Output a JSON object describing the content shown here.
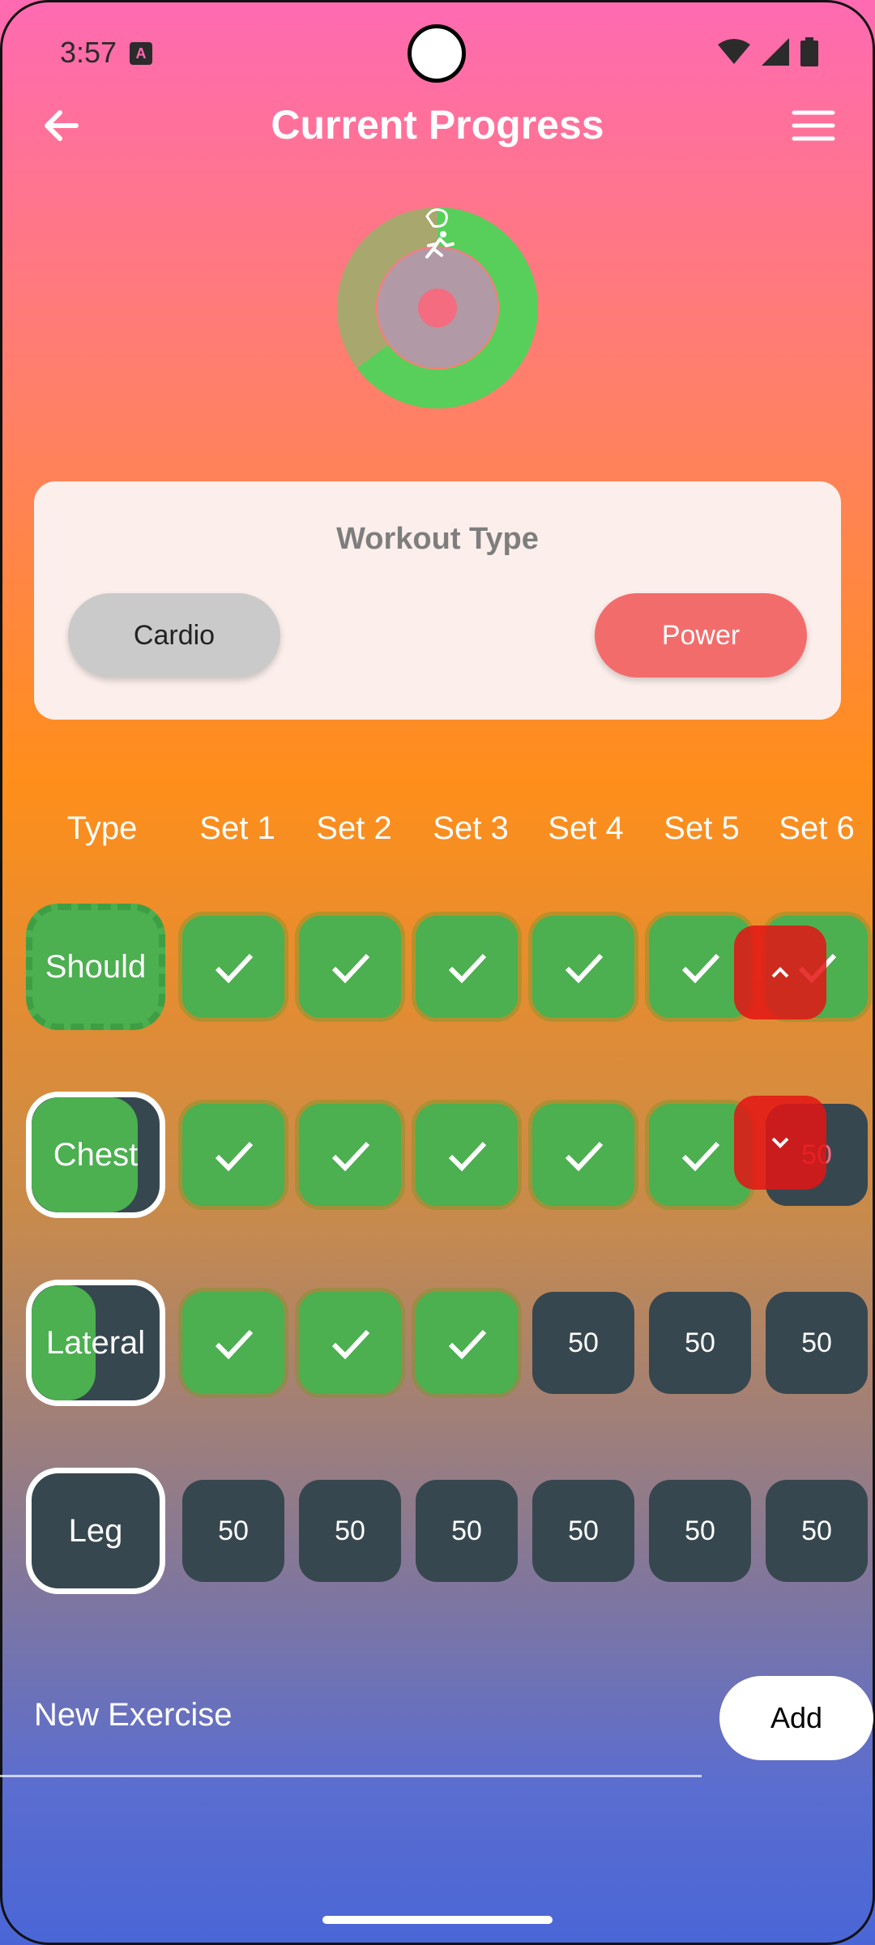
{
  "status": {
    "time": "3:57"
  },
  "header": {
    "title": "Current Progress"
  },
  "workout_card": {
    "title": "Workout Type",
    "options": [
      "Cardio",
      "Power"
    ],
    "selected": "Power"
  },
  "table": {
    "headers": [
      "Type",
      "Set 1",
      "Set 2",
      "Set 3",
      "Set 4",
      "Set 5",
      "Set 6"
    ],
    "rows": [
      {
        "name": "Should",
        "sets": [
          "done",
          "done",
          "done",
          "done",
          "done",
          "done"
        ],
        "progress": 1.0
      },
      {
        "name": "Chest",
        "sets": [
          "done",
          "done",
          "done",
          "done",
          "done",
          "50"
        ],
        "progress": 0.83
      },
      {
        "name": "Lateral",
        "sets": [
          "done",
          "done",
          "done",
          "50",
          "50",
          "50"
        ],
        "progress": 0.5
      },
      {
        "name": "Leg",
        "sets": [
          "50",
          "50",
          "50",
          "50",
          "50",
          "50"
        ],
        "progress": 0.0
      }
    ]
  },
  "new_exercise": {
    "placeholder": "New Exercise",
    "add_label": "Add"
  },
  "colors": {
    "done": "#4caf50",
    "todo": "#37474f",
    "accent": "#f36c6c"
  }
}
